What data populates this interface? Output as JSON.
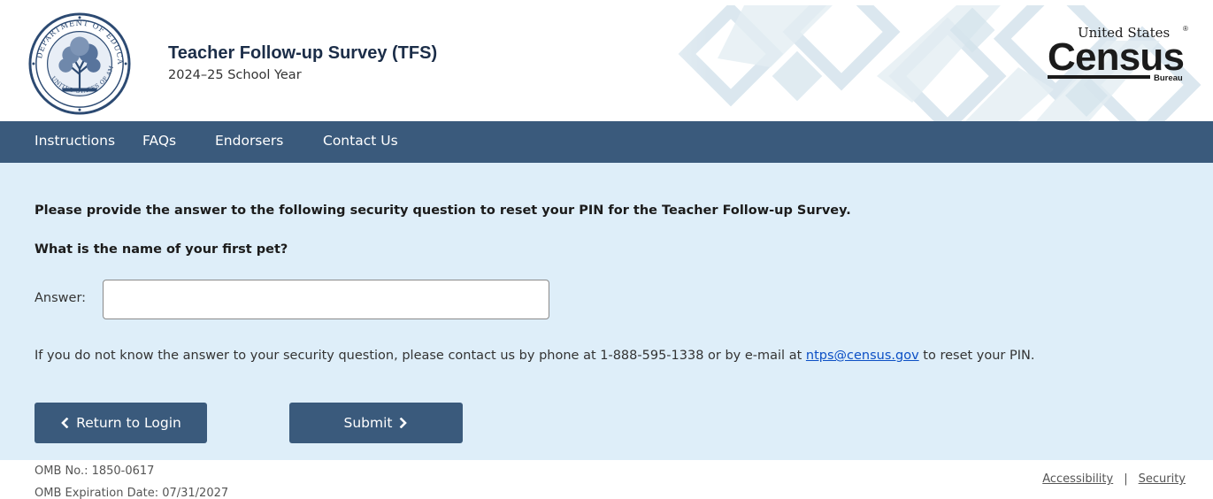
{
  "header": {
    "title": "Teacher Follow-up Survey (TFS)",
    "subtitle": "2024–25 School Year",
    "seal_text": "DEPARTMENT OF EDUCATION • UNITED STATES OF AMERICA",
    "census_logo": {
      "line1": "United States",
      "registered": "®",
      "word": "Census",
      "bureau": "Bureau"
    }
  },
  "nav": {
    "items": [
      {
        "label": "Instructions"
      },
      {
        "label": "FAQs"
      },
      {
        "label": "Endorsers"
      },
      {
        "label": "Contact Us"
      }
    ]
  },
  "main": {
    "instruction": "Please provide the answer to the following security question to reset your PIN for the Teacher Follow-up Survey.",
    "question": "What is the name of your first pet?",
    "answer_label": "Answer:",
    "answer_value": "",
    "help_before": "If you do not know the answer to your security question, please contact us by phone at 1-888-595-1338 or by e-mail at ",
    "help_link": "ntps@census.gov",
    "help_after": " to reset your PIN.",
    "return_label": "Return to Login",
    "submit_label": "Submit"
  },
  "footer": {
    "omb_no": "OMB No.: 1850-0617",
    "omb_exp": "OMB Expiration Date: 07/31/2027",
    "accessibility": "Accessibility",
    "separator": "|",
    "security": "Security"
  },
  "colors": {
    "nav_bg": "#3a5a7c",
    "main_bg": "#deeef9",
    "button_bg": "#3a5a7c",
    "link": "#0b4fc5"
  },
  "icons": {
    "return": "chevron-left-icon",
    "submit": "chevron-right-icon"
  }
}
